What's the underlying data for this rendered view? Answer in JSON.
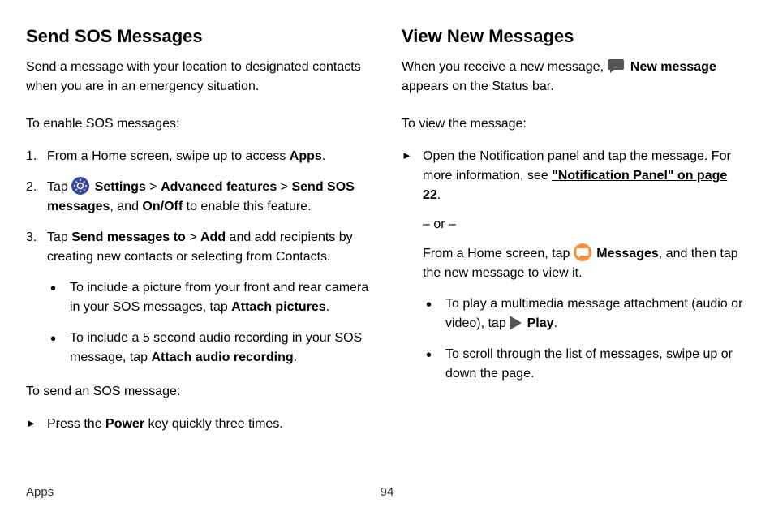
{
  "left": {
    "heading": "Send SOS Messages",
    "intro": "Send a message with your location to designated contacts when you are in an emergency situation.",
    "enable_lead": "To enable SOS messages:",
    "step1_pre": "From a Home screen, swipe up to access ",
    "step1_bold": "Apps",
    "step1_post": ".",
    "step2_pre": "Tap ",
    "step2_b1": "Settings",
    "step2_sep1": " > ",
    "step2_b2": "Advanced features",
    "step2_sep2": " > ",
    "step2_b3": "Send SOS messages",
    "step2_mid": ", and ",
    "step2_b4": "On/Off",
    "step2_post": " to enable this feature.",
    "step3_pre": "Tap ",
    "step3_b1": "Send messages to",
    "step3_sep1": " > ",
    "step3_b2": "Add",
    "step3_post": " and add recipients by creating new contacts or selecting from Contacts.",
    "bullet1_pre": "To include a picture from your front and rear camera in your SOS messages, tap ",
    "bullet1_bold": "Attach pictures",
    "bullet1_post": ".",
    "bullet2_pre": "To include a 5 second audio recording in your SOS message, tap ",
    "bullet2_bold": "Attach audio recording",
    "bullet2_post": ".",
    "send_lead": "To send an SOS message:",
    "send_step_pre": "Press the ",
    "send_step_bold": "Power",
    "send_step_post": " key quickly three times."
  },
  "right": {
    "heading": "View New Messages",
    "intro_pre": "When you receive a new message, ",
    "intro_bold": "New message",
    "intro_post": " appears on the Status bar.",
    "view_lead": "To view the message:",
    "step1_pre": "Open the Notification panel and tap the message. For more information, see ",
    "step1_link": "\"Notification Panel\" on page 22",
    "step1_post": ".",
    "or_text": "– or –",
    "step1b_pre": "From a Home screen, tap ",
    "step1b_bold": "Messages",
    "step1b_post": ", and then tap the new message to view it.",
    "bullet1_pre": "To play a multimedia message attachment (audio or video), tap ",
    "bullet1_bold": "Play",
    "bullet1_post": ".",
    "bullet2": "To scroll through the list of messages, swipe up or down the page."
  },
  "footer": {
    "section": "Apps",
    "page": "94"
  }
}
